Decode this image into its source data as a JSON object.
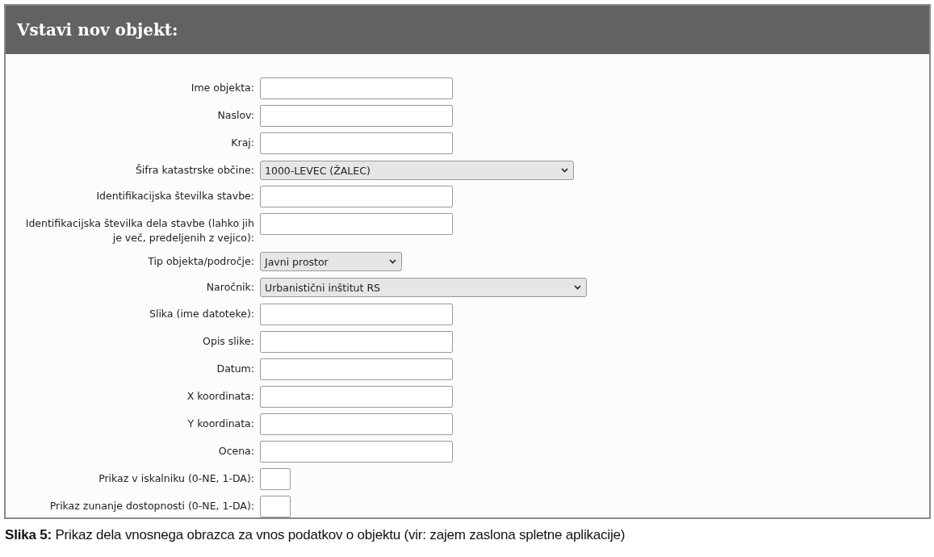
{
  "window": {
    "title": "Vstavi nov objekt:"
  },
  "fields": [
    {
      "label": "Ime objekta:",
      "kind": "text"
    },
    {
      "label": "Naslov:",
      "kind": "text"
    },
    {
      "label": "Kraj:",
      "kind": "text"
    },
    {
      "label": "Šifra katastrske občine:",
      "kind": "select",
      "value": "1000-LEVEC (ŽALEC)"
    },
    {
      "label": "Identifikacijska številka stavbe:",
      "kind": "text"
    },
    {
      "label": "Identifikacijska številka dela stavbe (lahko jih je več, predeljenih z vejico):",
      "kind": "text"
    },
    {
      "label": "Tip objekta/področje:",
      "kind": "shortselect",
      "value": "Javni prostor"
    },
    {
      "label": "Naročnik:",
      "kind": "longselect",
      "value": "Urbanistični inštitut RS"
    },
    {
      "label": "Slika (ime datoteke):",
      "kind": "text"
    },
    {
      "label": "Opis slike:",
      "kind": "text"
    },
    {
      "label": "Datum:",
      "kind": "text"
    },
    {
      "label": "X koordinata:",
      "kind": "text"
    },
    {
      "label": "Y koordinata:",
      "kind": "text"
    },
    {
      "label": "Ocena:",
      "kind": "text"
    },
    {
      "label": "Prikaz v iskalniku (0-NE, 1-DA):",
      "kind": "tiny"
    },
    {
      "label": "Prikaz zunanje dostopnosti (0-NE, 1-DA):",
      "kind": "tiny"
    }
  ],
  "caption": "**Slika 5:** Prikaz dela vnosnega obrazca za vnos podatkov o objektu (vir: zajem zaslona spletne aplikacije)"
}
